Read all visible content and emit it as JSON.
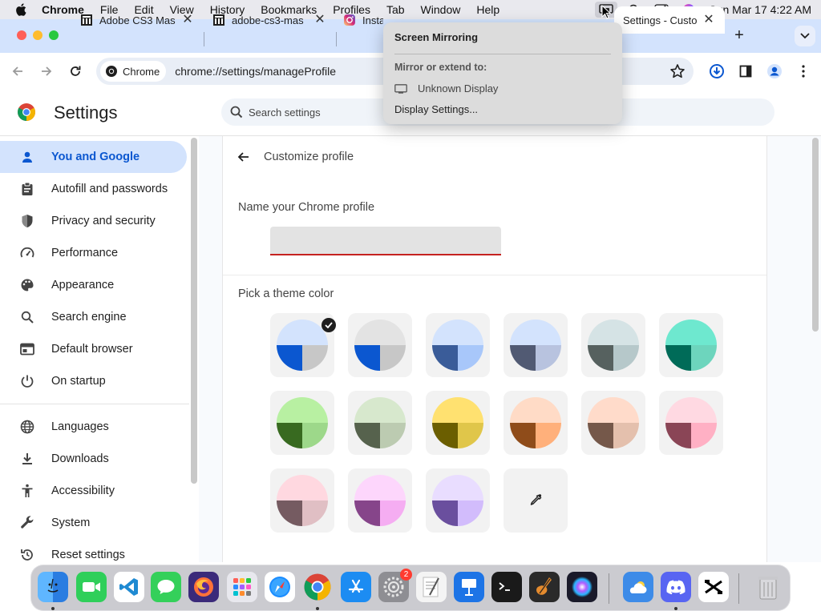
{
  "menubar": {
    "app_name": "Chrome",
    "menus": [
      "File",
      "Edit",
      "View",
      "History",
      "Bookmarks",
      "Profiles",
      "Tab",
      "Window",
      "Help"
    ],
    "clock": "Sun Mar 17  4:22 AM"
  },
  "tabs": [
    {
      "title": "Adobe CS3 Mas",
      "icon": "archive-icon"
    },
    {
      "title": "adobe-cs3-mas",
      "icon": "archive-icon"
    },
    {
      "title": "Insta",
      "icon": "instagram-icon"
    },
    {
      "title": "Settings - Custo",
      "icon": "settings-icon",
      "active": true
    }
  ],
  "toolbar": {
    "chip_label": "Chrome",
    "url": "chrome://settings/manageProfile"
  },
  "settings": {
    "title": "Settings",
    "search_placeholder": "Search settings"
  },
  "sidebar": {
    "items": [
      {
        "label": "You and Google",
        "icon": "person-icon",
        "active": true
      },
      {
        "label": "Autofill and passwords",
        "icon": "clipboard-icon"
      },
      {
        "label": "Privacy and security",
        "icon": "shield-icon"
      },
      {
        "label": "Performance",
        "icon": "speedometer-icon"
      },
      {
        "label": "Appearance",
        "icon": "palette-icon"
      },
      {
        "label": "Search engine",
        "icon": "search-icon"
      },
      {
        "label": "Default browser",
        "icon": "browser-icon"
      },
      {
        "label": "On startup",
        "icon": "power-icon"
      },
      {
        "label": "Languages",
        "icon": "globe-icon"
      },
      {
        "label": "Downloads",
        "icon": "download-icon"
      },
      {
        "label": "Accessibility",
        "icon": "accessibility-icon"
      },
      {
        "label": "System",
        "icon": "wrench-icon"
      },
      {
        "label": "Reset settings",
        "icon": "reset-icon"
      }
    ]
  },
  "main": {
    "subtitle": "Customize profile",
    "name_label": "Name your Chrome profile",
    "name_value": "",
    "theme_label": "Pick a theme color",
    "themes": [
      {
        "top": "#d3e3fd",
        "left": "#0b57d0",
        "right": "#c7c7c7",
        "selected": true
      },
      {
        "top": "#e3e3e3",
        "left": "#0b57d0",
        "right": "#c7c7c7"
      },
      {
        "top": "#d3e3fd",
        "left": "#3a5c99",
        "right": "#a8c7fa"
      },
      {
        "top": "#d3e3fd",
        "left": "#515a73",
        "right": "#b8c3df"
      },
      {
        "top": "#d5e3e5",
        "left": "#56615f",
        "right": "#b6c8ca"
      },
      {
        "top": "#6ee8cf",
        "left": "#006b58",
        "right": "#6dd5bd"
      },
      {
        "top": "#b8f0a2",
        "left": "#386a20",
        "right": "#9dd88a"
      },
      {
        "top": "#d7e8cd",
        "left": "#56624d",
        "right": "#bccbb1"
      },
      {
        "top": "#ffe170",
        "left": "#6b5e00",
        "right": "#e0c64a"
      },
      {
        "top": "#ffdbc6",
        "left": "#8f4c1a",
        "right": "#ffb07b"
      },
      {
        "top": "#ffdbca",
        "left": "#75584a",
        "right": "#e4c0ad"
      },
      {
        "top": "#ffd9e2",
        "left": "#8a4556",
        "right": "#ffb0c4"
      },
      {
        "top": "#ffd8e0",
        "left": "#755b61",
        "right": "#e0bfc4"
      },
      {
        "top": "#fdd6fc",
        "left": "#86458a",
        "right": "#f5adf2"
      },
      {
        "top": "#e9ddff",
        "left": "#6a4f9e",
        "right": "#d2bcfc"
      }
    ],
    "custom_icon": "eyedropper-icon"
  },
  "popover": {
    "title": "Screen Mirroring",
    "subtitle": "Mirror or extend to:",
    "device": "Unknown Display",
    "link": "Display Settings..."
  },
  "dock": {
    "messages_badge": "",
    "settings_badge": "2",
    "apps": [
      "Finder",
      "FaceTime",
      "Visual Studio Code",
      "Messages",
      "Firefox",
      "Launchpad",
      "Safari",
      "Chrome",
      "App Store",
      "System Settings",
      "TextEdit",
      "Keynote",
      "Terminal",
      "GarageBand",
      "Siri",
      "Weather",
      "Discord",
      "CapCut",
      "Trash"
    ]
  }
}
